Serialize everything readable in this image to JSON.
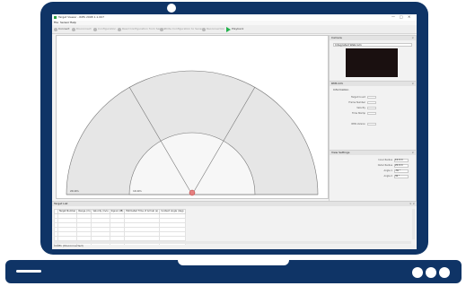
{
  "window": {
    "title": "Target Viewer - RMS 2008 1.1.007",
    "minimize": "—",
    "maximize": "□",
    "close": "✕"
  },
  "menu": [
    "File",
    "Sensor",
    "Help"
  ],
  "toolbar": {
    "connect": "Connect",
    "disconnect": "Disconnect",
    "configuration": "Configuration",
    "read_configuration": "Read Configuration from Sensor",
    "write_configuration": "Write Configuration to Sensor",
    "reconnection": "Reconnection",
    "playback": "Playback"
  },
  "plot": {
    "range_labels": [
      "10.0m",
      "20.0m"
    ]
  },
  "camera_panel": {
    "title": "Camera",
    "device": "Integrated Webcam"
  },
  "info_panel": {
    "title": "RMS Info",
    "group": "Information",
    "rows": [
      {
        "label": "Target Count",
        "value": ""
      },
      {
        "label": "Frame Number",
        "value": ""
      },
      {
        "label": "Velocity",
        "value": ""
      },
      {
        "label": "Time Stamp",
        "value": ""
      }
    ],
    "extra_label": "RMS Version",
    "extra_value": ""
  },
  "view_panel": {
    "title": "View Settings",
    "rows": [
      {
        "label": "Inner Radius",
        "value": "10.0 m"
      },
      {
        "label": "Outer Radius",
        "value": "20.0 m"
      },
      {
        "label": "Angle 1",
        "value": "-30 °"
      },
      {
        "label": "Angle 2",
        "value": "30 °"
      }
    ]
  },
  "target_list": {
    "title": "Target List",
    "columns": [
      "Target Number",
      "Range (m)",
      "Velocity (m/s)",
      "Signal (dB)",
      "Estimated Time of Arrival (s)",
      "Incident Angle (deg)"
    ],
    "row_count": 7
  },
  "status_bar": {
    "text": "COM1 (Disconnected)"
  },
  "colors": {
    "frame": "#0f3466",
    "playback_icon": "#22b14c",
    "target_marker": "#d9534f"
  }
}
